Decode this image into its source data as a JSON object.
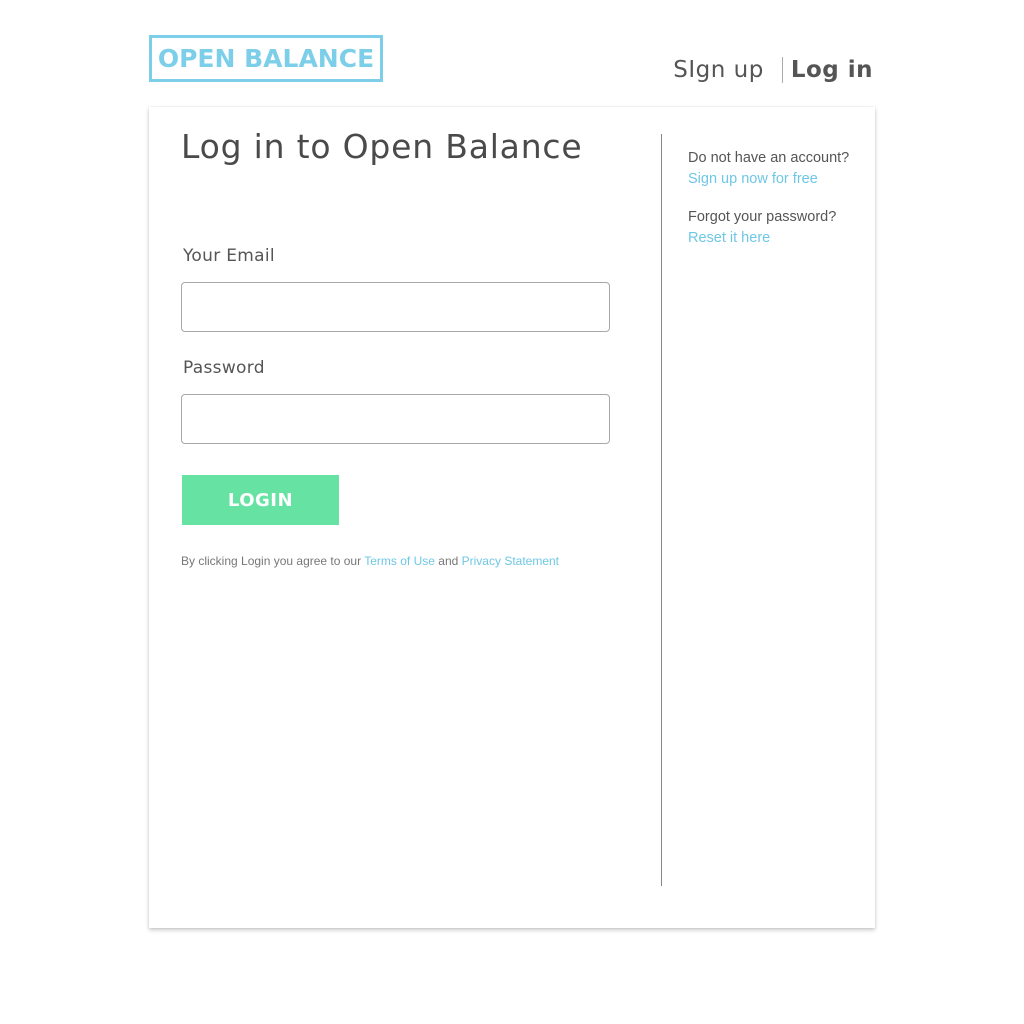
{
  "brand": {
    "logo_text": "OPEN BALANCE",
    "accent_color": "#7dcfe9",
    "button_color": "#66e3a3"
  },
  "header": {
    "signup_label": "SIgn up",
    "login_label": "Log in"
  },
  "form": {
    "title": "Log in to Open Balance",
    "email_label": "Your Email",
    "email_value": "",
    "password_label": "Password",
    "password_value": "",
    "submit_label": "LOGIN",
    "terms_prefix": "By clicking Login you agree to our",
    "terms_link": "Terms of Use",
    "terms_and": "and",
    "privacy_link": "Privacy Statement"
  },
  "sidebar": {
    "no_account_text": "Do not have an account?",
    "signup_link": "Sign up now for free",
    "forgot_text": "Forgot your password?",
    "reset_link": "Reset it here"
  }
}
